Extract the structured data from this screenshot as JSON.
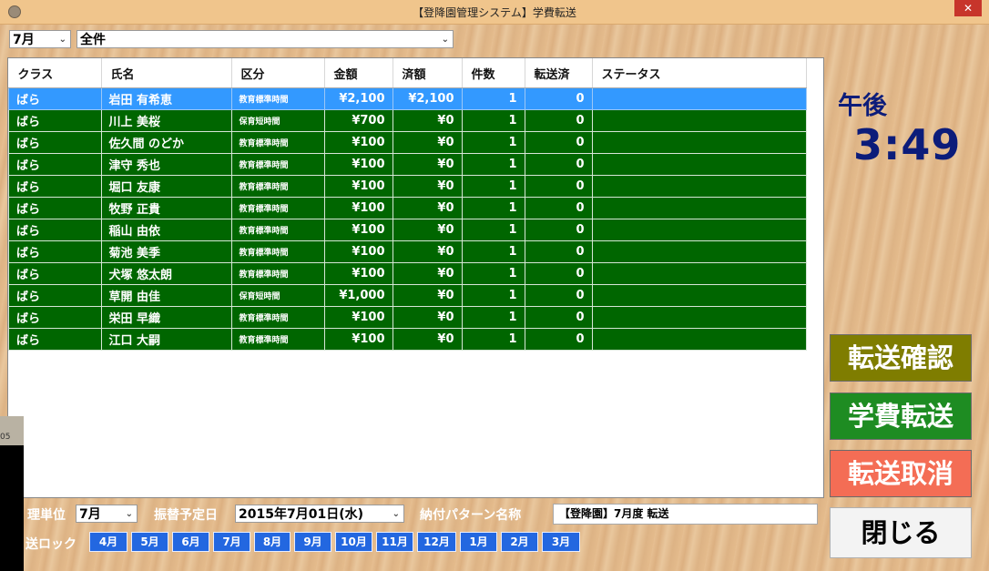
{
  "window": {
    "title": "【登降園管理システム】学費転送",
    "close_glyph": "✕"
  },
  "filters": {
    "month": "7月",
    "scope": "全件"
  },
  "table": {
    "headers": [
      "クラス",
      "氏名",
      "区分",
      "金額",
      "済額",
      "件数",
      "転送済",
      "ステータス"
    ],
    "rows": [
      [
        "ばら",
        "岩田 有希恵",
        "教育標準時間",
        "¥2,100",
        "¥2,100",
        "1",
        "0",
        ""
      ],
      [
        "ばら",
        "川上 美桜",
        "保育短時間",
        "¥700",
        "¥0",
        "1",
        "0",
        ""
      ],
      [
        "ばら",
        "佐久間 のどか",
        "教育標準時間",
        "¥100",
        "¥0",
        "1",
        "0",
        ""
      ],
      [
        "ばら",
        "津守 秀也",
        "教育標準時間",
        "¥100",
        "¥0",
        "1",
        "0",
        ""
      ],
      [
        "ばら",
        "堀口 友康",
        "教育標準時間",
        "¥100",
        "¥0",
        "1",
        "0",
        ""
      ],
      [
        "ばら",
        "牧野 正貴",
        "教育標準時間",
        "¥100",
        "¥0",
        "1",
        "0",
        ""
      ],
      [
        "ばら",
        "稲山 由依",
        "教育標準時間",
        "¥100",
        "¥0",
        "1",
        "0",
        ""
      ],
      [
        "ばら",
        "菊池 美季",
        "教育標準時間",
        "¥100",
        "¥0",
        "1",
        "0",
        ""
      ],
      [
        "ばら",
        "犬塚 悠太朗",
        "教育標準時間",
        "¥100",
        "¥0",
        "1",
        "0",
        ""
      ],
      [
        "ばら",
        "草開 由佳",
        "保育短時間",
        "¥1,000",
        "¥0",
        "1",
        "0",
        ""
      ],
      [
        "ばら",
        "栄田 早織",
        "教育標準時間",
        "¥100",
        "¥0",
        "1",
        "0",
        ""
      ],
      [
        "ばら",
        "江口 大嗣",
        "教育標準時間",
        "¥100",
        "¥0",
        "1",
        "0",
        ""
      ]
    ],
    "selected_row": 0
  },
  "clock": {
    "period": "午後",
    "time": "3:49"
  },
  "buttons": {
    "confirm": "転送確認",
    "transfer": "学費転送",
    "cancel": "転送取消",
    "close": "閉じる"
  },
  "bottom": {
    "unit_label": "理単位",
    "unit_value": "7月",
    "date_label": "振替予定日",
    "date_value": "2015年7月01日(水)",
    "pattern_label": "納付パターン名称",
    "pattern_value": "【登降園】7月度 転送",
    "lock_label": "送ロック",
    "months": [
      "4月",
      "5月",
      "6月",
      "7月",
      "8月",
      "9月",
      "10月",
      "11月",
      "12月",
      "1月",
      "2月",
      "3月"
    ]
  },
  "side_strip_text": "05",
  "colors": {
    "row_green": "#006600",
    "row_selected": "#3399ff",
    "confirm_bg": "#7f7d00",
    "transfer_bg": "#1e8c22",
    "cancel_bg": "#f46d55",
    "month_btn": "#2367e0",
    "clock": "#0c1c7a"
  },
  "icons": {
    "app": "app-icon",
    "dropdown": "chevron-down-icon"
  }
}
